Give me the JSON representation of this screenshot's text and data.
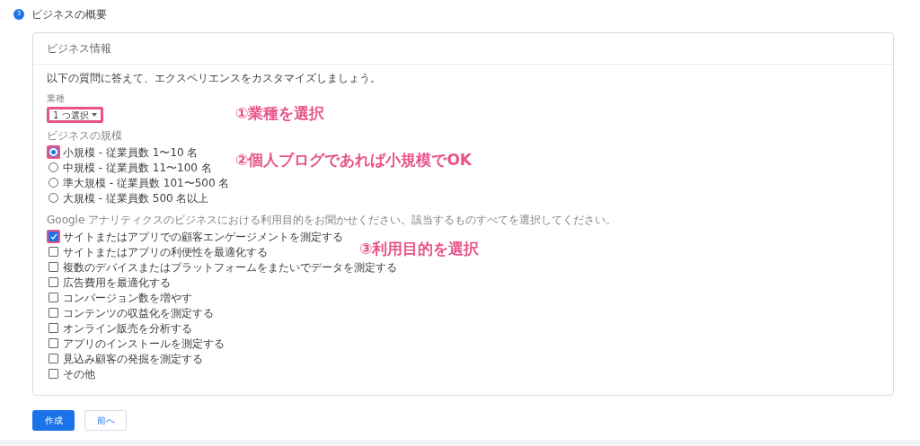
{
  "step": {
    "number": "3",
    "title": "ビジネスの概要"
  },
  "card": {
    "title": "ビジネス情報",
    "intro": "以下の質問に答えて、エクスペリエンスをカスタマイズしましょう。",
    "industry": {
      "label": "業種",
      "value": "1 つ選択",
      "highlighted": true
    },
    "size": {
      "label": "ビジネスの規模",
      "options": [
        {
          "label": "小規模 - 従業員数 1〜10 名",
          "selected": true,
          "highlighted": true
        },
        {
          "label": "中規模 - 従業員数 11〜100 名",
          "selected": false,
          "highlighted": false
        },
        {
          "label": "準大規模 - 従業員数 101〜500 名",
          "selected": false,
          "highlighted": false
        },
        {
          "label": "大規模 - 従業員数 500 名以上",
          "selected": false,
          "highlighted": false
        }
      ]
    },
    "purpose": {
      "label": "Google アナリティクスのビジネスにおける利用目的をお聞かせください。該当するものすべてを選択してください。",
      "options": [
        {
          "label": "サイトまたはアプリでの顧客エンゲージメントを測定する",
          "checked": true,
          "highlighted": true
        },
        {
          "label": "サイトまたはアプリの利便性を最適化する",
          "checked": false,
          "highlighted": false
        },
        {
          "label": "複数のデバイスまたはプラットフォームをまたいでデータを測定する",
          "checked": false,
          "highlighted": false
        },
        {
          "label": "広告費用を最適化する",
          "checked": false,
          "highlighted": false
        },
        {
          "label": "コンバージョン数を増やす",
          "checked": false,
          "highlighted": false
        },
        {
          "label": "コンテンツの収益化を測定する",
          "checked": false,
          "highlighted": false
        },
        {
          "label": "オンライン販売を分析する",
          "checked": false,
          "highlighted": false
        },
        {
          "label": "アプリのインストールを測定する",
          "checked": false,
          "highlighted": false
        },
        {
          "label": "見込み顧客の発掘を測定する",
          "checked": false,
          "highlighted": false
        },
        {
          "label": "その他",
          "checked": false,
          "highlighted": false
        }
      ]
    }
  },
  "buttons": [
    {
      "label": "作成",
      "kind": "primary"
    },
    {
      "label": "前へ",
      "kind": "secondary"
    }
  ],
  "annotations": [
    "①業種を選択",
    "②個人ブログであれば小規模でOK",
    "③利用目的を選択"
  ]
}
